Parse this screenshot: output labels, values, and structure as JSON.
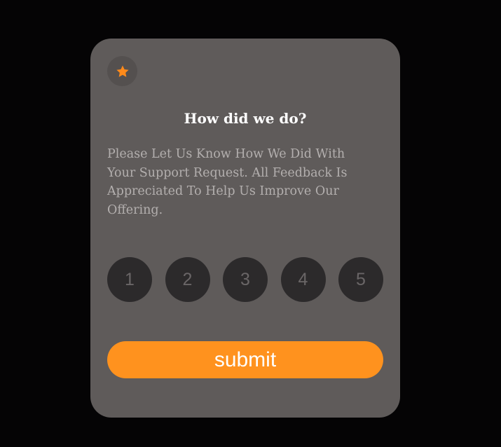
{
  "card": {
    "icon": "star-icon",
    "title": "How did we do?",
    "description": "Please Let Us Know How We Did With Your Support Request. All Feedback Is Appreciated To Help Us Improve Our Offering.",
    "ratings": [
      "1",
      "2",
      "3",
      "4",
      "5"
    ],
    "submit_label": "submit"
  },
  "colors": {
    "background": "#050405",
    "card": "#5f5b5a",
    "accent": "#ff921e",
    "rating_button": "#2c2a2b"
  }
}
